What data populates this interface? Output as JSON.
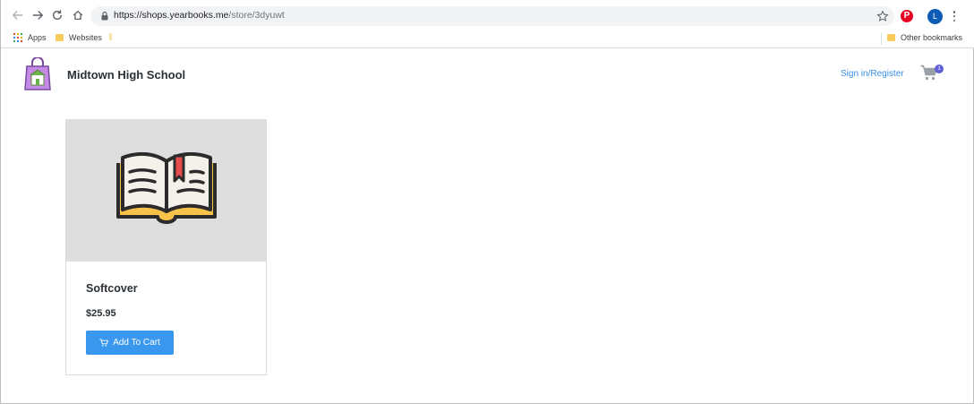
{
  "browser": {
    "url_host": "https://shops.yearbooks.me",
    "url_path": "/store/3dyuwt",
    "profile_initial": "L",
    "pinterest_glyph": "P",
    "bookmarks": {
      "apps_label": "Apps",
      "websites_label": "Websites",
      "other_label": "Other bookmarks"
    }
  },
  "header": {
    "school_name": "Midtown High School",
    "signin_label": "Sign in/Register",
    "cart_count": "1"
  },
  "products": [
    {
      "name": "Softcover",
      "price": "$25.95",
      "button_label": "Add To Cart",
      "image_icon": "open-book-icon"
    }
  ],
  "colors": {
    "accent": "#3a97ee",
    "link": "#3a8ee6",
    "badge": "#6060d8",
    "card_image_bg": "#dedede"
  }
}
